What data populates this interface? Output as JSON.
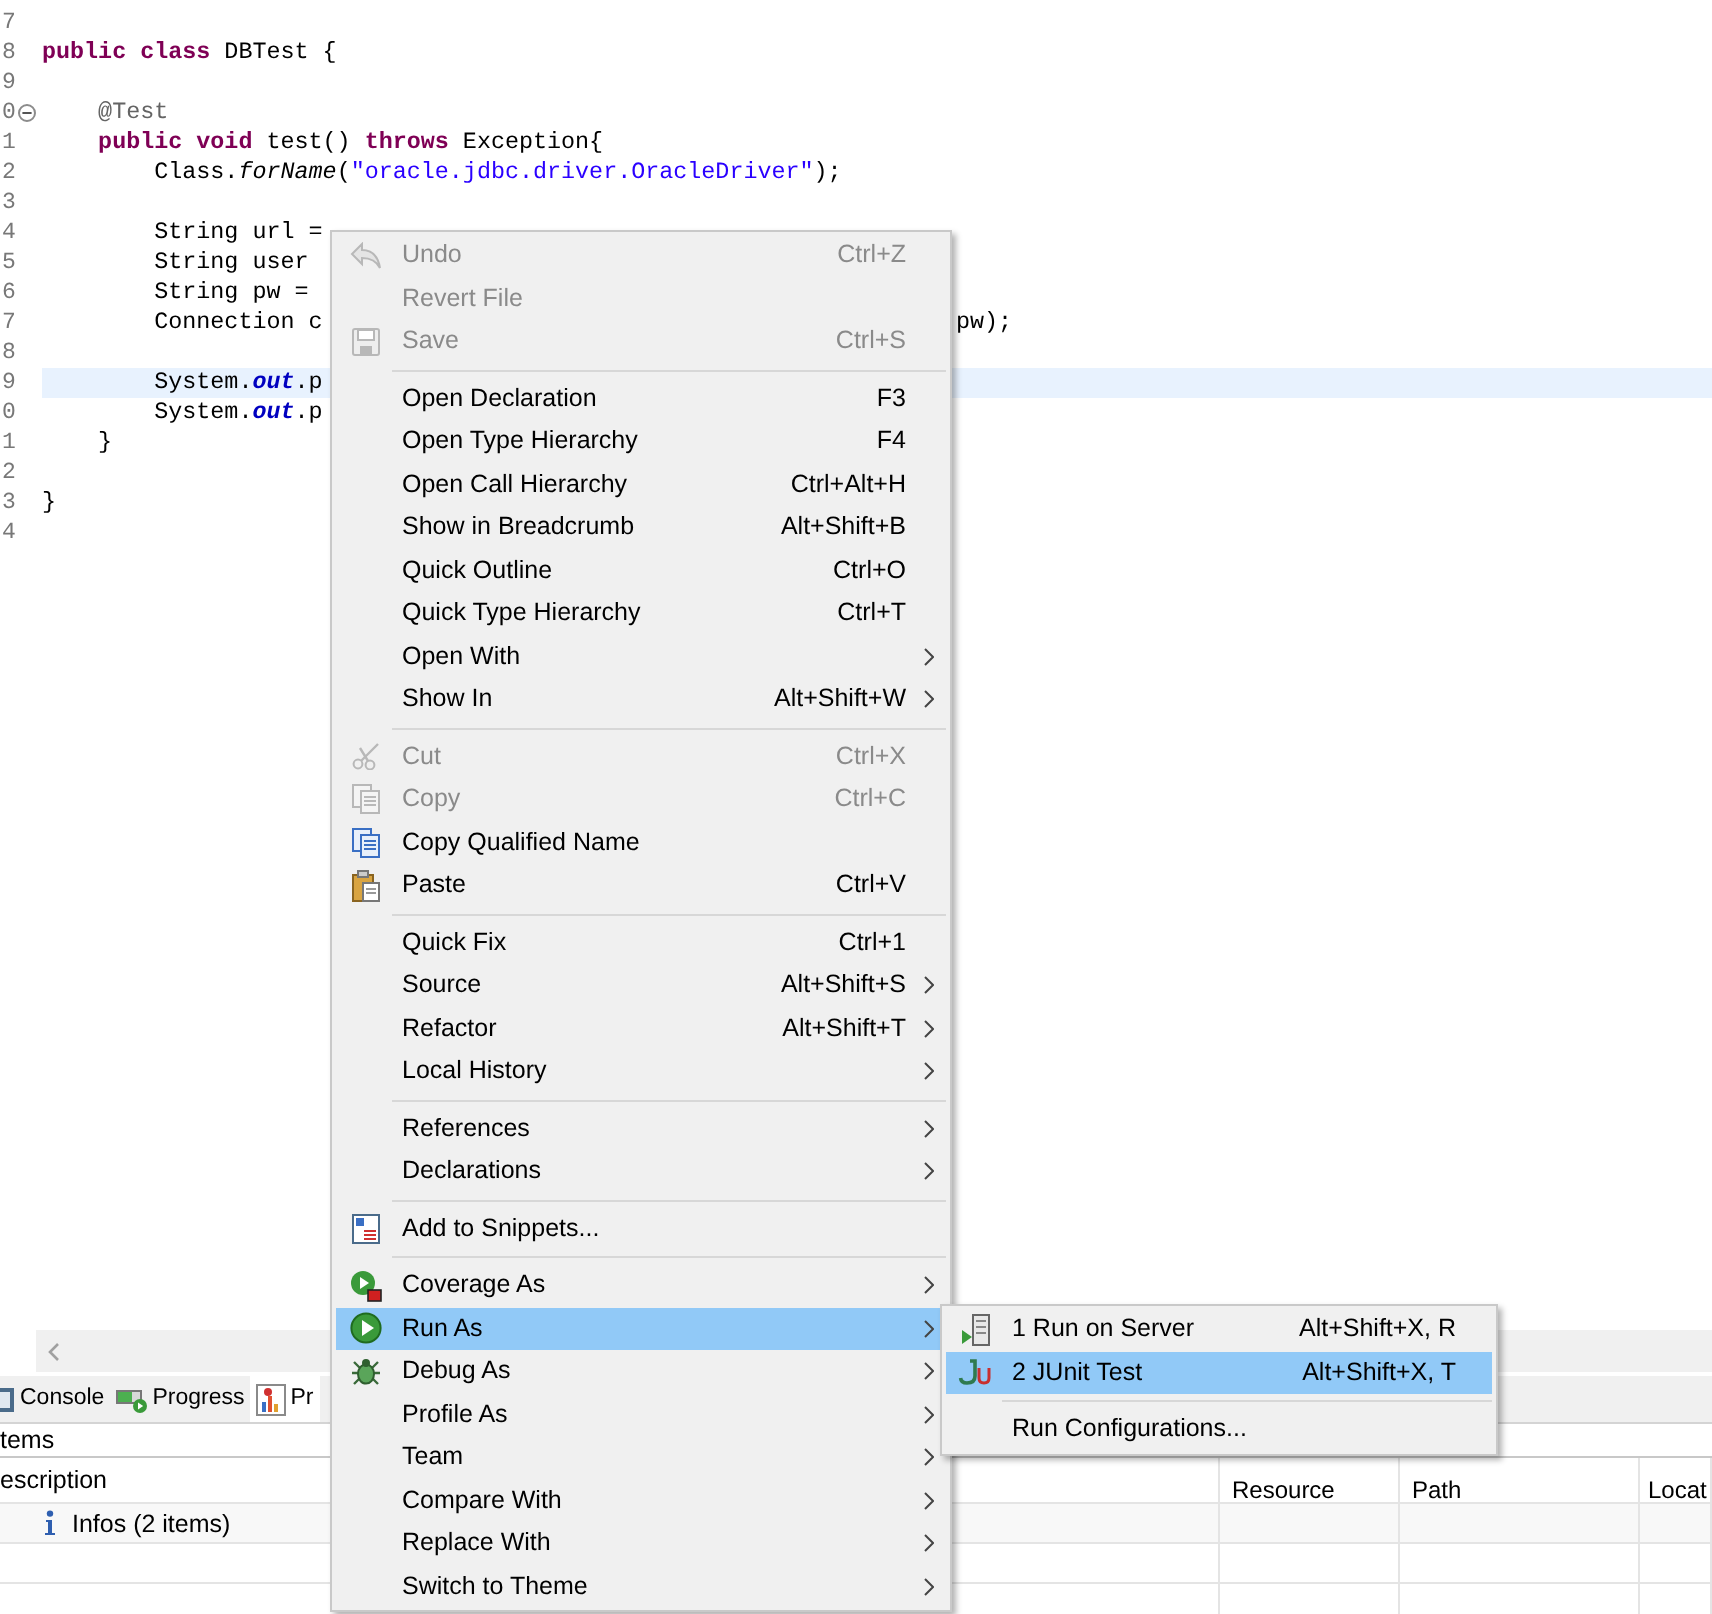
{
  "editor": {
    "lines": [
      {
        "number": "7",
        "current": false,
        "collapsible": false
      },
      {
        "number": "8",
        "current": false,
        "collapsible": false,
        "tokens": [
          {
            "text": "public class",
            "kind": "keyword"
          },
          {
            "text": " DBTest {",
            "kind": "plain"
          }
        ]
      },
      {
        "number": "9",
        "current": false,
        "collapsible": false
      },
      {
        "number": "0",
        "current": false,
        "collapsible": true,
        "tokens": [
          {
            "text": "    @Test",
            "kind": "annotation"
          }
        ]
      },
      {
        "number": "1",
        "current": false,
        "collapsible": false,
        "tokens": [
          {
            "text": "    public void",
            "kind": "keyword"
          },
          {
            "text": " test() ",
            "kind": "plain"
          },
          {
            "text": "throws",
            "kind": "keyword"
          },
          {
            "text": " Exception{",
            "kind": "plain"
          }
        ]
      },
      {
        "number": "2",
        "current": false,
        "collapsible": false,
        "tokens": [
          {
            "text": "        Class.",
            "kind": "plain"
          },
          {
            "text": "forName",
            "kind": "method"
          },
          {
            "text": "(",
            "kind": "plain"
          },
          {
            "text": "\"oracle.jdbc.driver.OracleDriver\"",
            "kind": "string"
          },
          {
            "text": ");",
            "kind": "plain"
          }
        ]
      },
      {
        "number": "3",
        "current": false,
        "collapsible": false
      },
      {
        "number": "4",
        "current": false,
        "collapsible": false,
        "tokens": [
          {
            "text": "        String url =",
            "kind": "plain"
          }
        ]
      },
      {
        "number": "5",
        "current": false,
        "collapsible": false,
        "tokens": [
          {
            "text": "        String user",
            "kind": "plain"
          }
        ]
      },
      {
        "number": "6",
        "current": false,
        "collapsible": false,
        "tokens": [
          {
            "text": "        String pw =",
            "kind": "plain"
          }
        ]
      },
      {
        "number": "7",
        "current": false,
        "collapsible": false,
        "tokens": [
          {
            "text": "        Connection c",
            "kind": "plain"
          }
        ],
        "tail": "pw);"
      },
      {
        "number": "8",
        "current": false,
        "collapsible": false
      },
      {
        "number": "9",
        "current": true,
        "collapsible": false,
        "tokens": [
          {
            "text": "        System.",
            "kind": "plain"
          },
          {
            "text": "out",
            "kind": "field"
          },
          {
            "text": ".p",
            "kind": "plain"
          }
        ]
      },
      {
        "number": "0",
        "current": false,
        "collapsible": false,
        "tokens": [
          {
            "text": "        System.",
            "kind": "plain"
          },
          {
            "text": "out",
            "kind": "field"
          },
          {
            "text": ".p",
            "kind": "plain"
          }
        ]
      },
      {
        "number": "1",
        "current": false,
        "collapsible": false,
        "tokens": [
          {
            "text": "    }",
            "kind": "plain"
          }
        ]
      },
      {
        "number": "2",
        "current": false,
        "collapsible": false
      },
      {
        "number": "3",
        "current": false,
        "collapsible": false,
        "tokens": [
          {
            "text": "}",
            "kind": "plain"
          }
        ]
      },
      {
        "number": "4",
        "current": false,
        "collapsible": false
      }
    ]
  },
  "bottom_panel": {
    "tabs": [
      {
        "label": "Console",
        "selected": false
      },
      {
        "label": "Progress",
        "selected": false
      },
      {
        "label": "Pr",
        "selected": true
      }
    ],
    "summary": "tems",
    "table": {
      "columns": [
        "escription",
        "Resource",
        "Path",
        "Locat"
      ],
      "rows": [
        {
          "description": "Infos (2 items)"
        }
      ]
    }
  },
  "context_menu": {
    "items": [
      {
        "kind": "item",
        "label": "Undo",
        "shortcut": "Ctrl+Z",
        "submenu": false,
        "disabled": true,
        "selected": false
      },
      {
        "kind": "item",
        "label": "Revert File",
        "submenu": false,
        "disabled": true,
        "selected": false
      },
      {
        "kind": "item",
        "label": "Save",
        "shortcut": "Ctrl+S",
        "submenu": false,
        "disabled": true,
        "selected": false
      },
      {
        "kind": "separator"
      },
      {
        "kind": "item",
        "label": "Open Declaration",
        "shortcut": "F3",
        "submenu": false,
        "disabled": false,
        "selected": false
      },
      {
        "kind": "item",
        "label": "Open Type Hierarchy",
        "shortcut": "F4",
        "submenu": false,
        "disabled": false,
        "selected": false
      },
      {
        "kind": "item",
        "label": "Open Call Hierarchy",
        "shortcut": "Ctrl+Alt+H",
        "submenu": false,
        "disabled": false,
        "selected": false
      },
      {
        "kind": "item",
        "label": "Show in Breadcrumb",
        "shortcut": "Alt+Shift+B",
        "submenu": false,
        "disabled": false,
        "selected": false
      },
      {
        "kind": "item",
        "label": "Quick Outline",
        "shortcut": "Ctrl+O",
        "submenu": false,
        "disabled": false,
        "selected": false
      },
      {
        "kind": "item",
        "label": "Quick Type Hierarchy",
        "shortcut": "Ctrl+T",
        "submenu": false,
        "disabled": false,
        "selected": false
      },
      {
        "kind": "item",
        "label": "Open With",
        "submenu": true,
        "disabled": false,
        "selected": false
      },
      {
        "kind": "item",
        "label": "Show In",
        "shortcut": "Alt+Shift+W",
        "submenu": true,
        "disabled": false,
        "selected": false
      },
      {
        "kind": "separator"
      },
      {
        "kind": "item",
        "label": "Cut",
        "shortcut": "Ctrl+X",
        "submenu": false,
        "disabled": true,
        "selected": false
      },
      {
        "kind": "item",
        "label": "Copy",
        "shortcut": "Ctrl+C",
        "submenu": false,
        "disabled": true,
        "selected": false
      },
      {
        "kind": "item",
        "label": "Copy Qualified Name",
        "submenu": false,
        "disabled": false,
        "selected": false
      },
      {
        "kind": "item",
        "label": "Paste",
        "shortcut": "Ctrl+V",
        "submenu": false,
        "disabled": false,
        "selected": false
      },
      {
        "kind": "separator"
      },
      {
        "kind": "item",
        "label": "Quick Fix",
        "shortcut": "Ctrl+1",
        "submenu": false,
        "disabled": false,
        "selected": false
      },
      {
        "kind": "item",
        "label": "Source",
        "shortcut": "Alt+Shift+S",
        "submenu": true,
        "disabled": false,
        "selected": false
      },
      {
        "kind": "item",
        "label": "Refactor",
        "shortcut": "Alt+Shift+T",
        "submenu": true,
        "disabled": false,
        "selected": false
      },
      {
        "kind": "item",
        "label": "Local History",
        "submenu": true,
        "disabled": false,
        "selected": false
      },
      {
        "kind": "separator"
      },
      {
        "kind": "item",
        "label": "References",
        "submenu": true,
        "disabled": false,
        "selected": false
      },
      {
        "kind": "item",
        "label": "Declarations",
        "submenu": true,
        "disabled": false,
        "selected": false
      },
      {
        "kind": "separator"
      },
      {
        "kind": "item",
        "label": "Add to Snippets...",
        "submenu": false,
        "disabled": false,
        "selected": false
      },
      {
        "kind": "separator"
      },
      {
        "kind": "item",
        "label": "Coverage As",
        "submenu": true,
        "disabled": false,
        "selected": false
      },
      {
        "kind": "item",
        "label": "Run As",
        "submenu": true,
        "disabled": false,
        "selected": true
      },
      {
        "kind": "item",
        "label": "Debug As",
        "submenu": true,
        "disabled": false,
        "selected": false
      },
      {
        "kind": "item",
        "label": "Profile As",
        "submenu": true,
        "disabled": false,
        "selected": false
      },
      {
        "kind": "item",
        "label": "Team",
        "submenu": true,
        "disabled": false,
        "selected": false
      },
      {
        "kind": "item",
        "label": "Compare With",
        "submenu": true,
        "disabled": false,
        "selected": false
      },
      {
        "kind": "item",
        "label": "Replace With",
        "submenu": true,
        "disabled": false,
        "selected": false
      },
      {
        "kind": "item",
        "label": "Switch to Theme",
        "submenu": true,
        "disabled": false,
        "selected": false
      }
    ]
  },
  "submenu": {
    "items": [
      {
        "kind": "item",
        "label": "1 Run on Server",
        "shortcut": "Alt+Shift+X, R",
        "selected": false
      },
      {
        "kind": "item",
        "label": "2 JUnit Test",
        "shortcut": "Alt+Shift+X, T",
        "selected": true
      },
      {
        "kind": "separator"
      },
      {
        "kind": "item",
        "label": "Run Configurations...",
        "selected": false
      }
    ]
  }
}
